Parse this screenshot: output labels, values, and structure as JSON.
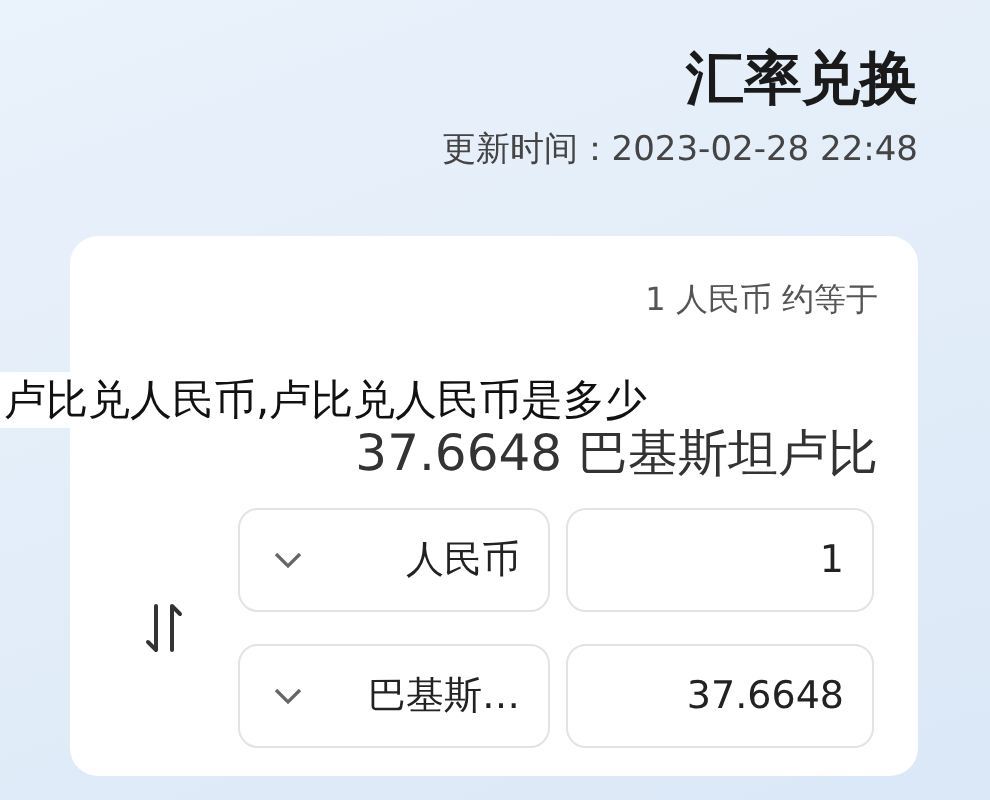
{
  "header": {
    "title": "汇率兑换",
    "updated": "更新时间：2023-02-28 22:48"
  },
  "converter": {
    "rate_label": "1 人民币 约等于",
    "result": "37.6648 巴基斯坦卢比",
    "rows": [
      {
        "amount": "1",
        "currency": "人民币"
      },
      {
        "amount": "37.6648",
        "currency": "巴基斯…"
      }
    ]
  },
  "caption": "卢比兑人民币,卢比兑人民币是多少"
}
